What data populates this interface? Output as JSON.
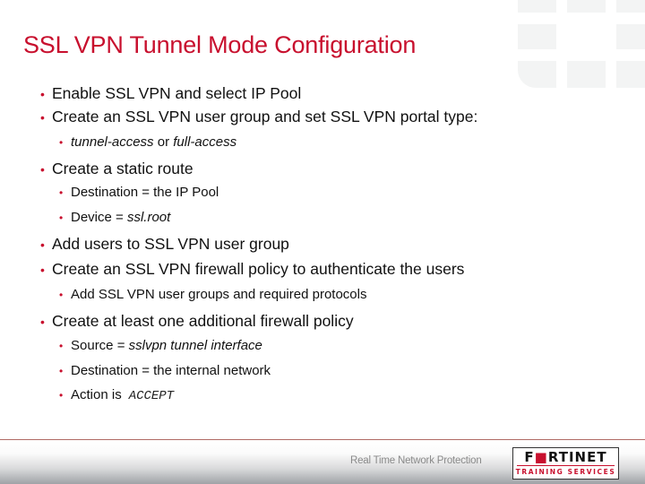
{
  "slide": {
    "title": "SSL VPN Tunnel Mode Configuration",
    "bullets": [
      {
        "level": 1,
        "parts": [
          {
            "text": "Enable SSL VPN and select IP Pool"
          }
        ]
      },
      {
        "level": 1,
        "parts": [
          {
            "text": "Create an SSL VPN user group and set SSL VPN portal type:"
          }
        ]
      },
      {
        "level": 2,
        "parts": [
          {
            "text": "tunnel-access",
            "style": "italic"
          },
          {
            "text": " or "
          },
          {
            "text": "full-access",
            "style": "italic"
          }
        ]
      },
      {
        "level": 1,
        "parts": [
          {
            "text": "Create a static route"
          }
        ]
      },
      {
        "level": 2,
        "parts": [
          {
            "text": "Destination = the IP Pool"
          }
        ]
      },
      {
        "level": 2,
        "parts": [
          {
            "text": "Device = "
          },
          {
            "text": "ssl.root",
            "style": "italic"
          }
        ]
      },
      {
        "level": 1,
        "parts": [
          {
            "text": "Add users to SSL VPN user group"
          }
        ]
      },
      {
        "level": 1,
        "parts": [
          {
            "text": "Create an SSL VPN firewall policy to authenticate the users"
          }
        ]
      },
      {
        "level": 2,
        "parts": [
          {
            "text": "Add SSL VPN user groups and required protocols"
          }
        ]
      },
      {
        "level": 1,
        "parts": [
          {
            "text": "Create at least one additional firewall policy"
          }
        ]
      },
      {
        "level": 2,
        "parts": [
          {
            "text": "Source = "
          },
          {
            "text": "sslvpn tunnel interface",
            "style": "italic"
          }
        ]
      },
      {
        "level": 2,
        "parts": [
          {
            "text": "Destination = the internal network"
          }
        ]
      },
      {
        "level": 2,
        "parts": [
          {
            "text": "Action is"
          },
          {
            "text": "ACCEPT",
            "style": "mono"
          }
        ]
      }
    ],
    "bullet_glyph": "•"
  },
  "footer": {
    "tagline": "Real Time Network Protection",
    "logo": {
      "word_prefix": "F",
      "word_o": "■",
      "word_suffix": "RTINET",
      "subtitle": "TRAINING SERVICES"
    }
  },
  "colors": {
    "accent_red": "#c8102e",
    "text": "#111111",
    "footer_rule": "#b06a64"
  },
  "icons": {
    "watermark": "fortinet-grid-logo-icon",
    "bullet": "red-dot-bullet-icon"
  }
}
